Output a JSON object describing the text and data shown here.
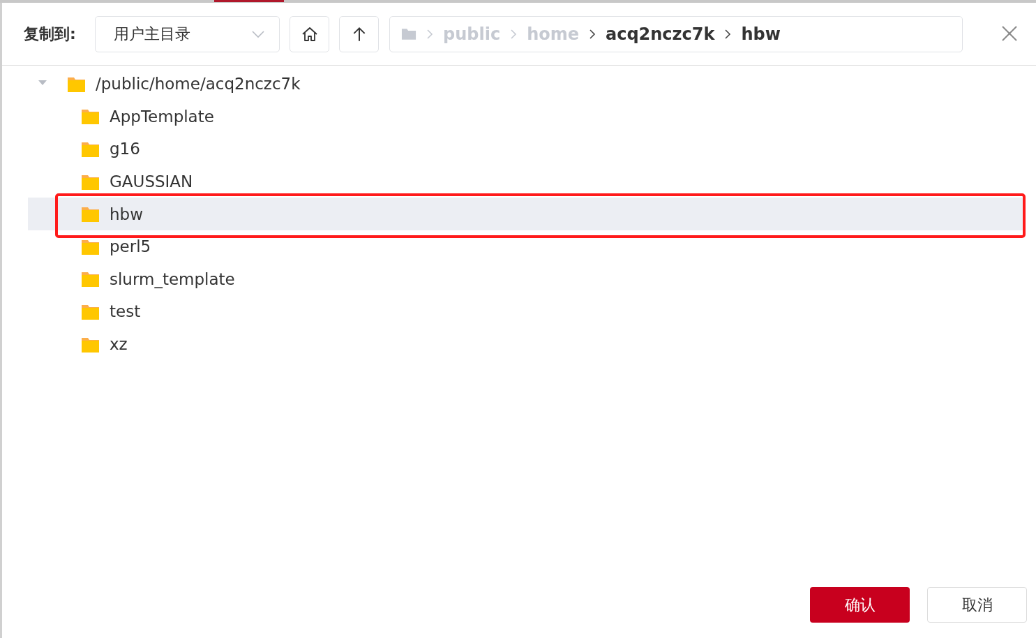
{
  "dialog": {
    "label": "复制到:",
    "location_select": {
      "value": "用户主目录"
    },
    "breadcrumb": [
      {
        "label": "public",
        "dimmed": true
      },
      {
        "label": "home",
        "dimmed": true
      },
      {
        "label": "acq2nczc7k",
        "dimmed": false
      },
      {
        "label": "hbw",
        "dimmed": false
      }
    ],
    "tree": [
      {
        "label": "/public/home/acq2nczc7k",
        "expanded": true,
        "selected": false,
        "children": [
          {
            "label": "AppTemplate",
            "selected": false
          },
          {
            "label": "g16",
            "selected": false
          },
          {
            "label": "GAUSSIAN",
            "selected": false
          },
          {
            "label": "hbw",
            "selected": true,
            "annotated": true
          },
          {
            "label": "perl5",
            "selected": false
          },
          {
            "label": "slurm_template",
            "selected": false
          },
          {
            "label": "test",
            "selected": false
          },
          {
            "label": "xz",
            "selected": false
          }
        ]
      }
    ],
    "buttons": [
      {
        "label": "确认",
        "kind": "primary"
      },
      {
        "label": "取消",
        "kind": "secondary"
      }
    ]
  }
}
